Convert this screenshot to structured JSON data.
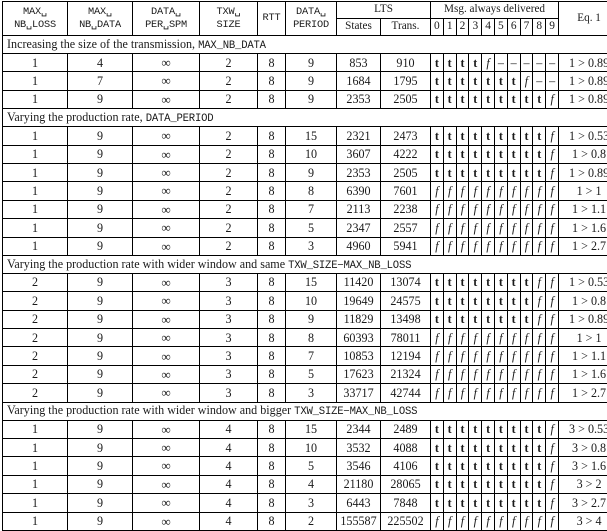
{
  "table": {
    "header": {
      "col_max_nb_loss": [
        "MAX␣",
        "NB␣LOSS"
      ],
      "col_max_nb_data": [
        "MAX␣",
        "NB␣DATA"
      ],
      "col_data_per_spm": [
        "DATA␣",
        "PER␣SPM"
      ],
      "col_txw_size": [
        "TXW␣",
        "SIZE"
      ],
      "col_rtt": "RTT",
      "col_data_period": [
        "DATA␣",
        "PERIOD"
      ],
      "group_lts": "LTS",
      "col_states": "States",
      "col_trans": "Trans.",
      "group_msg": "Msg. always delivered",
      "msg_indices": [
        "0",
        "1",
        "2",
        "3",
        "4",
        "5",
        "6",
        "7",
        "8",
        "9"
      ],
      "col_eq": "Eq. 1"
    },
    "sections": [
      {
        "title_prefix": "Increasing the size of the transmission, ",
        "title_mono": "MAX_NB_DATA",
        "rows": [
          {
            "max_nb_loss": "1",
            "max_nb_data": "4",
            "data_per_spm": "∞",
            "txw_size": "2",
            "rtt": "8",
            "data_period": "9",
            "states": "853",
            "trans": "910",
            "msg": [
              "t",
              "t",
              "t",
              "t",
              "f",
              "–",
              "–",
              "–",
              "–",
              "–"
            ],
            "eq": "1 > 0.89"
          },
          {
            "max_nb_loss": "1",
            "max_nb_data": "7",
            "data_per_spm": "∞",
            "txw_size": "2",
            "rtt": "8",
            "data_period": "9",
            "states": "1684",
            "trans": "1795",
            "msg": [
              "t",
              "t",
              "t",
              "t",
              "t",
              "t",
              "t",
              "f",
              "–",
              "–"
            ],
            "eq": "1 > 0.89"
          },
          {
            "max_nb_loss": "1",
            "max_nb_data": "9",
            "data_per_spm": "∞",
            "txw_size": "2",
            "rtt": "8",
            "data_period": "9",
            "states": "2353",
            "trans": "2505",
            "msg": [
              "t",
              "t",
              "t",
              "t",
              "t",
              "t",
              "t",
              "t",
              "t",
              "f"
            ],
            "eq": "1 > 0.89"
          }
        ]
      },
      {
        "title_prefix": "Varying the production rate, ",
        "title_mono": "DATA_PERIOD",
        "rows": [
          {
            "max_nb_loss": "1",
            "max_nb_data": "9",
            "data_per_spm": "∞",
            "txw_size": "2",
            "rtt": "8",
            "data_period": "15",
            "states": "2321",
            "trans": "2473",
            "msg": [
              "t",
              "t",
              "t",
              "t",
              "t",
              "t",
              "t",
              "t",
              "t",
              "f"
            ],
            "eq": "1 > 0.53"
          },
          {
            "max_nb_loss": "1",
            "max_nb_data": "9",
            "data_per_spm": "∞",
            "txw_size": "2",
            "rtt": "8",
            "data_period": "10",
            "states": "3607",
            "trans": "4222",
            "msg": [
              "t",
              "t",
              "t",
              "t",
              "t",
              "t",
              "t",
              "t",
              "t",
              "f"
            ],
            "eq": "1 > 0.8"
          },
          {
            "max_nb_loss": "1",
            "max_nb_data": "9",
            "data_per_spm": "∞",
            "txw_size": "2",
            "rtt": "8",
            "data_period": "9",
            "states": "2353",
            "trans": "2505",
            "msg": [
              "t",
              "t",
              "t",
              "t",
              "t",
              "t",
              "t",
              "t",
              "t",
              "f"
            ],
            "eq": "1 > 0.89"
          },
          {
            "max_nb_loss": "1",
            "max_nb_data": "9",
            "data_per_spm": "∞",
            "txw_size": "2",
            "rtt": "8",
            "data_period": "8",
            "states": "6390",
            "trans": "7601",
            "msg": [
              "f",
              "f",
              "f",
              "f",
              "f",
              "f",
              "f",
              "f",
              "f",
              "f"
            ],
            "eq": "1 > 1"
          },
          {
            "max_nb_loss": "1",
            "max_nb_data": "9",
            "data_per_spm": "∞",
            "txw_size": "2",
            "rtt": "8",
            "data_period": "7",
            "states": "2113",
            "trans": "2238",
            "msg": [
              "f",
              "f",
              "f",
              "f",
              "f",
              "f",
              "f",
              "f",
              "f",
              "f"
            ],
            "eq": "1 > 1.1"
          },
          {
            "max_nb_loss": "1",
            "max_nb_data": "9",
            "data_per_spm": "∞",
            "txw_size": "2",
            "rtt": "8",
            "data_period": "5",
            "states": "2347",
            "trans": "2557",
            "msg": [
              "f",
              "f",
              "f",
              "f",
              "f",
              "f",
              "f",
              "f",
              "f",
              "f"
            ],
            "eq": "1 > 1.6"
          },
          {
            "max_nb_loss": "1",
            "max_nb_data": "9",
            "data_per_spm": "∞",
            "txw_size": "2",
            "rtt": "8",
            "data_period": "3",
            "states": "4960",
            "trans": "5941",
            "msg": [
              "f",
              "f",
              "f",
              "f",
              "f",
              "f",
              "f",
              "f",
              "f",
              "f"
            ],
            "eq": "1 > 2.7"
          }
        ]
      },
      {
        "title_prefix": "Varying the production rate with wider window and same ",
        "title_mono": "TXW_SIZE−MAX_NB_LOSS",
        "rows": [
          {
            "max_nb_loss": "2",
            "max_nb_data": "9",
            "data_per_spm": "∞",
            "txw_size": "3",
            "rtt": "8",
            "data_period": "15",
            "states": "11420",
            "trans": "13074",
            "msg": [
              "t",
              "t",
              "t",
              "t",
              "t",
              "t",
              "t",
              "t",
              "f",
              "f"
            ],
            "eq": "1 > 0.53"
          },
          {
            "max_nb_loss": "2",
            "max_nb_data": "9",
            "data_per_spm": "∞",
            "txw_size": "3",
            "rtt": "8",
            "data_period": "10",
            "states": "19649",
            "trans": "24575",
            "msg": [
              "t",
              "t",
              "t",
              "t",
              "t",
              "t",
              "t",
              "t",
              "f",
              "f"
            ],
            "eq": "1 > 0.8"
          },
          {
            "max_nb_loss": "2",
            "max_nb_data": "9",
            "data_per_spm": "∞",
            "txw_size": "3",
            "rtt": "8",
            "data_period": "9",
            "states": "11829",
            "trans": "13498",
            "msg": [
              "t",
              "t",
              "t",
              "t",
              "t",
              "t",
              "t",
              "t",
              "f",
              "f"
            ],
            "eq": "1 > 0.89"
          },
          {
            "max_nb_loss": "2",
            "max_nb_data": "9",
            "data_per_spm": "∞",
            "txw_size": "3",
            "rtt": "8",
            "data_period": "8",
            "states": "60393",
            "trans": "78011",
            "msg": [
              "f",
              "f",
              "f",
              "f",
              "f",
              "f",
              "f",
              "f",
              "f",
              "f"
            ],
            "eq": "1 > 1"
          },
          {
            "max_nb_loss": "2",
            "max_nb_data": "9",
            "data_per_spm": "∞",
            "txw_size": "3",
            "rtt": "8",
            "data_period": "7",
            "states": "10853",
            "trans": "12194",
            "msg": [
              "f",
              "f",
              "f",
              "f",
              "f",
              "f",
              "f",
              "f",
              "f",
              "f"
            ],
            "eq": "1 > 1.1"
          },
          {
            "max_nb_loss": "2",
            "max_nb_data": "9",
            "data_per_spm": "∞",
            "txw_size": "3",
            "rtt": "8",
            "data_period": "5",
            "states": "17623",
            "trans": "21324",
            "msg": [
              "f",
              "f",
              "f",
              "f",
              "f",
              "f",
              "f",
              "f",
              "f",
              "f"
            ],
            "eq": "1 > 1.6"
          },
          {
            "max_nb_loss": "2",
            "max_nb_data": "9",
            "data_per_spm": "∞",
            "txw_size": "3",
            "rtt": "8",
            "data_period": "3",
            "states": "33717",
            "trans": "42744",
            "msg": [
              "f",
              "f",
              "f",
              "f",
              "f",
              "f",
              "f",
              "f",
              "f",
              "f"
            ],
            "eq": "1 > 2.7"
          }
        ]
      },
      {
        "title_prefix": "Varying the production rate with wider window and bigger ",
        "title_mono": "TXW_SIZE−MAX_NB_LOSS",
        "rows": [
          {
            "max_nb_loss": "1",
            "max_nb_data": "9",
            "data_per_spm": "∞",
            "txw_size": "4",
            "rtt": "8",
            "data_period": "15",
            "states": "2344",
            "trans": "2489",
            "msg": [
              "t",
              "t",
              "t",
              "t",
              "t",
              "t",
              "t",
              "t",
              "t",
              "f"
            ],
            "eq": "3 > 0.53"
          },
          {
            "max_nb_loss": "1",
            "max_nb_data": "9",
            "data_per_spm": "∞",
            "txw_size": "4",
            "rtt": "8",
            "data_period": "10",
            "states": "3532",
            "trans": "4088",
            "msg": [
              "t",
              "t",
              "t",
              "t",
              "t",
              "t",
              "t",
              "t",
              "t",
              "f"
            ],
            "eq": "3 > 0.8"
          },
          {
            "max_nb_loss": "1",
            "max_nb_data": "9",
            "data_per_spm": "∞",
            "txw_size": "4",
            "rtt": "8",
            "data_period": "5",
            "states": "3546",
            "trans": "4106",
            "msg": [
              "t",
              "t",
              "t",
              "t",
              "t",
              "t",
              "t",
              "t",
              "t",
              "f"
            ],
            "eq": "3 > 1.6"
          },
          {
            "max_nb_loss": "1",
            "max_nb_data": "9",
            "data_per_spm": "∞",
            "txw_size": "4",
            "rtt": "8",
            "data_period": "4",
            "states": "21180",
            "trans": "28065",
            "msg": [
              "t",
              "t",
              "t",
              "t",
              "t",
              "t",
              "t",
              "t",
              "t",
              "f"
            ],
            "eq": "3 > 2"
          },
          {
            "max_nb_loss": "1",
            "max_nb_data": "9",
            "data_per_spm": "∞",
            "txw_size": "4",
            "rtt": "8",
            "data_period": "3",
            "states": "6443",
            "trans": "7848",
            "msg": [
              "t",
              "t",
              "t",
              "t",
              "t",
              "t",
              "t",
              "t",
              "t",
              "f"
            ],
            "eq": "3 > 2.7"
          },
          {
            "max_nb_loss": "1",
            "max_nb_data": "9",
            "data_per_spm": "∞",
            "txw_size": "4",
            "rtt": "8",
            "data_period": "2",
            "states": "155587",
            "trans": "225502",
            "msg": [
              "f",
              "f",
              "f",
              "f",
              "f",
              "f",
              "f",
              "f",
              "f",
              "f"
            ],
            "eq": "3 > 4"
          }
        ]
      }
    ]
  }
}
